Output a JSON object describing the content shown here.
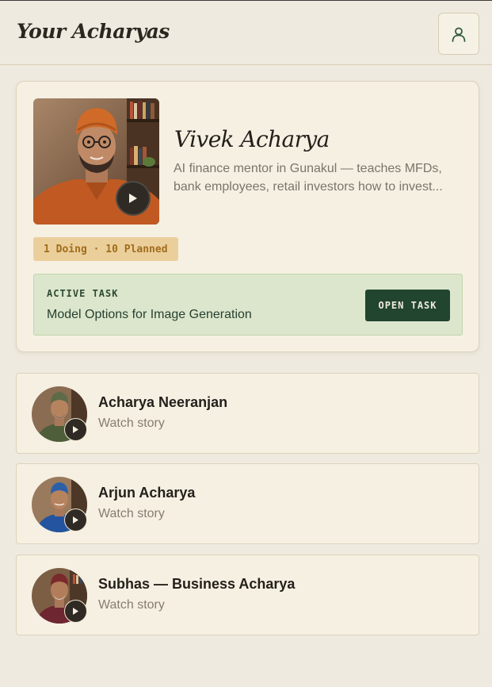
{
  "header": {
    "title": "Your Acharyas",
    "profile_icon": "user-icon"
  },
  "featured": {
    "name": "Vivek Acharya",
    "description": "AI finance mentor in Gunakul — teaches MFDs, bank employees, retail investors how to invest...",
    "status": "1 Doing · 10 Planned",
    "active_task_label": "ACTIVE TASK",
    "active_task_title": "Model Options for Image Generation",
    "open_task_label": "OPEN TASK",
    "play_icon": "play-icon"
  },
  "acharyas": [
    {
      "name": "Acharya Neeranjan",
      "subtitle": "Watch story",
      "turban_color": "#5d6b48",
      "shirt_color": "#4f5e3a"
    },
    {
      "name": "Arjun Acharya",
      "subtitle": "Watch story",
      "turban_color": "#2b5fa8",
      "shirt_color": "#2454a0"
    },
    {
      "name": "Subhas — Business Acharya",
      "subtitle": "Watch story",
      "turban_color": "#7a2a2a",
      "shirt_color": "#6e2630"
    }
  ],
  "colors": {
    "background": "#efeadf",
    "card": "#f6f0e3",
    "accent_green": "#21452f",
    "status_pill": "#ebcf9b",
    "task_box": "#dbe6cc"
  }
}
